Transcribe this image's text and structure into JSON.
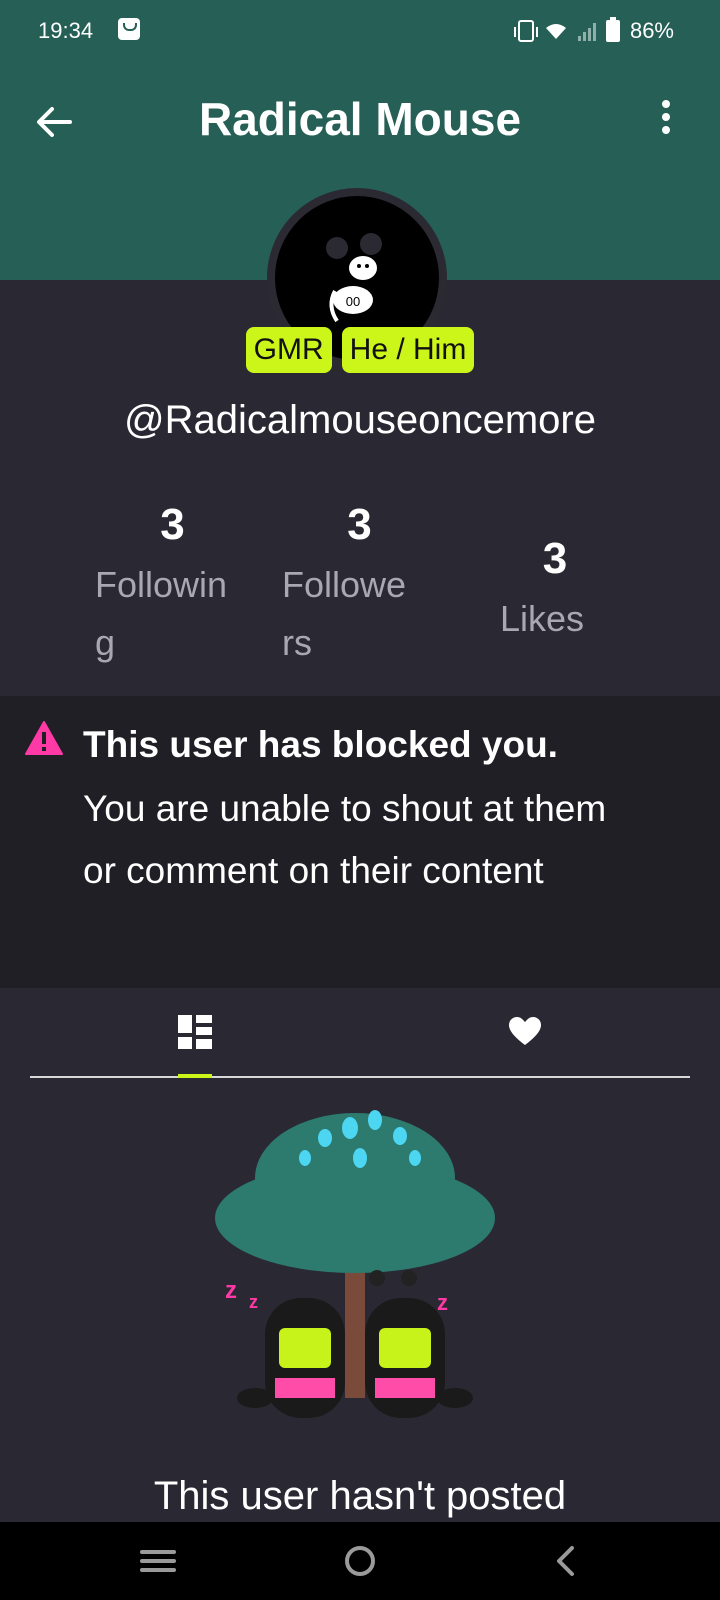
{
  "status_bar": {
    "time": "19:34",
    "battery": "86%",
    "icons": [
      "shopping-bag-icon",
      "vibrate-icon",
      "wifi-icon",
      "signal-icon",
      "battery-icon"
    ]
  },
  "app_bar": {
    "title": "Radical Mouse",
    "back_icon": "arrow-left-icon",
    "menu_icon": "more-vertical-icon",
    "background": "#255f55"
  },
  "profile": {
    "badges": [
      "GMR",
      "He / Him"
    ],
    "username": "@Radicalmouseoncemore",
    "stats": [
      {
        "value": "3",
        "label": "Followin g"
      },
      {
        "value": "3",
        "label": "Followe rs"
      },
      {
        "value": "3",
        "label": "Likes"
      }
    ]
  },
  "blocked_notice": {
    "title": "This user has blocked you.",
    "text": "You are unable to shout at them or comment on their content",
    "icon": "warning-icon",
    "icon_color": "#ff3aa6"
  },
  "tabs": {
    "items": [
      "posts-grid-icon",
      "heart-icon"
    ],
    "accent": "#ccf51a"
  },
  "empty_state": {
    "text": "This user hasn't posted"
  },
  "nav_bar": {
    "icons": [
      "recent-apps-icon",
      "home-icon",
      "back-icon"
    ]
  }
}
